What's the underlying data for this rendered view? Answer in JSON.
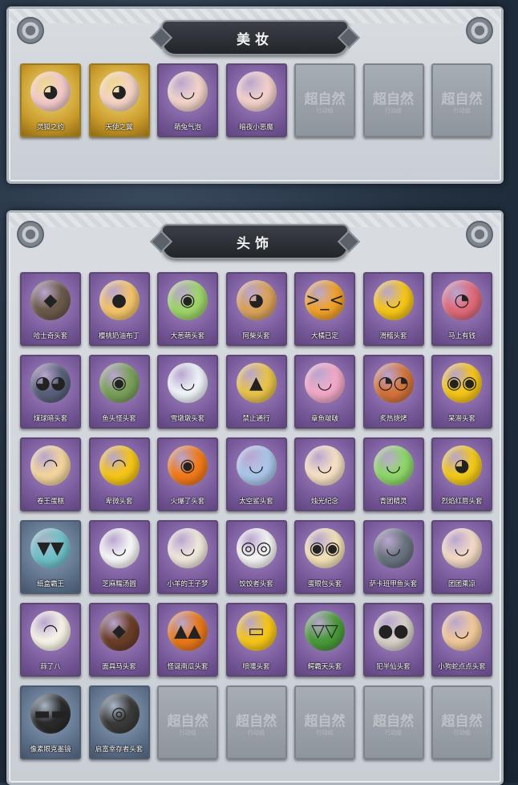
{
  "makeup": {
    "title": "美妆",
    "items": [
      {
        "label": "灵狐之约",
        "style": "gold",
        "icon": "fox-ear-head-icon",
        "glyph": "◕",
        "color": "#f2c9c9"
      },
      {
        "label": "天使之翼",
        "style": "gold",
        "icon": "angel-head-icon",
        "glyph": "◕",
        "color": "#f3d2c4"
      },
      {
        "label": "萌兔气泡",
        "style": "purple",
        "icon": "bunny-head-icon",
        "glyph": "◡",
        "color": "#f1d3c8"
      },
      {
        "label": "暗夜小恶魔",
        "style": "purple",
        "icon": "devil-head-icon",
        "glyph": "◡",
        "color": "#f3d0c9"
      },
      {
        "label": "",
        "style": "locked",
        "icon": "",
        "glyph": "",
        "color": ""
      },
      {
        "label": "",
        "style": "locked",
        "icon": "",
        "glyph": "",
        "color": ""
      },
      {
        "label": "",
        "style": "locked",
        "icon": "",
        "glyph": "",
        "color": ""
      }
    ]
  },
  "headwear": {
    "title": "头饰",
    "items": [
      {
        "label": "哈士奇头套",
        "style": "purple",
        "icon": "husky-head-icon",
        "glyph": "◆",
        "color": "#6b5a4a"
      },
      {
        "label": "樱桃奶油布丁",
        "style": "purple",
        "icon": "pudding-head-icon",
        "glyph": "●",
        "color": "#f2c36a"
      },
      {
        "label": "大葱萌头套",
        "style": "purple",
        "icon": "scallion-head-icon",
        "glyph": "◉",
        "color": "#9ed46a"
      },
      {
        "label": "阿柴头套",
        "style": "purple",
        "icon": "shiba-head-icon",
        "glyph": "◕",
        "color": "#d9a25a"
      },
      {
        "label": "大橘已定",
        "style": "purple",
        "icon": "orange-head-icon",
        "glyph": ">_<",
        "color": "#f0a12a"
      },
      {
        "label": "滑稽头套",
        "style": "purple",
        "icon": "funny-face-icon",
        "glyph": "◡",
        "color": "#f5c518"
      },
      {
        "label": "马上有钱",
        "style": "purple",
        "icon": "horse-money-icon",
        "glyph": "◔",
        "color": "#e06a7a"
      },
      {
        "label": "煤球暗头套",
        "style": "purple",
        "icon": "black-cat-icon",
        "glyph": "◕◕",
        "color": "#59607a"
      },
      {
        "label": "鱼头怪头套",
        "style": "purple",
        "icon": "fish-head-icon",
        "glyph": "◉",
        "color": "#7aa05a"
      },
      {
        "label": "雪墩墩头套",
        "style": "purple",
        "icon": "snowman-head-icon",
        "glyph": "◡",
        "color": "#eef3f8"
      },
      {
        "label": "禁止通行",
        "style": "purple",
        "icon": "traffic-cone-icon",
        "glyph": "▲",
        "color": "#e8c34a"
      },
      {
        "label": "章鱼啵啵",
        "style": "purple",
        "icon": "octopus-head-icon",
        "glyph": "◡",
        "color": "#f2a8c6"
      },
      {
        "label": "炙热烧烤",
        "style": "purple",
        "icon": "sausage-head-icon",
        "glyph": "◔◔",
        "color": "#d4733a"
      },
      {
        "label": "呆滞头套",
        "style": "purple",
        "icon": "dazed-face-icon",
        "glyph": "◉◉",
        "color": "#f5c518"
      },
      {
        "label": "卷王蛋糕",
        "style": "purple",
        "icon": "roll-cake-icon",
        "glyph": "◠",
        "color": "#f2d49c"
      },
      {
        "label": "卑微头套",
        "style": "purple",
        "icon": "humble-face-icon",
        "glyph": "◠",
        "color": "#f5c518"
      },
      {
        "label": "火爆了头套",
        "style": "purple",
        "icon": "fire-head-icon",
        "glyph": "◉",
        "color": "#f27a1a"
      },
      {
        "label": "太空鲨头套",
        "style": "purple",
        "icon": "shark-head-icon",
        "glyph": "◡",
        "color": "#a9c6e8"
      },
      {
        "label": "烛光纪念",
        "style": "purple",
        "icon": "candle-head-icon",
        "glyph": "◡",
        "color": "#f6e0c4"
      },
      {
        "label": "青团精灵",
        "style": "purple",
        "icon": "green-dumpling-icon",
        "glyph": "◡",
        "color": "#8ed66a"
      },
      {
        "label": "烈焰红唇头套",
        "style": "purple",
        "icon": "yellow-mouse-icon",
        "glyph": "◕",
        "color": "#f2c91a"
      },
      {
        "label": "纸盒霸王",
        "style": "blue",
        "icon": "box-dino-icon",
        "glyph": "▼▼",
        "color": "#6fc0c8"
      },
      {
        "label": "芝麻糯汤圆",
        "style": "purple",
        "icon": "rice-ball-icon",
        "glyph": "◡",
        "color": "#f6f6f6"
      },
      {
        "label": "小羊的王子梦",
        "style": "purple",
        "icon": "sheep-crown-icon",
        "glyph": "◡",
        "color": "#efe7dc"
      },
      {
        "label": "饺饺者头套",
        "style": "purple",
        "icon": "dumpling-head-icon",
        "glyph": "◎◎",
        "color": "#f4f4f4"
      },
      {
        "label": "蛋眼包头套",
        "style": "purple",
        "icon": "bun-head-icon",
        "glyph": "◉◉",
        "color": "#f3e1b6"
      },
      {
        "label": "萨卡班甲鱼头套",
        "style": "purple",
        "icon": "ancient-fish-icon",
        "glyph": "◡",
        "color": "#6a7480"
      },
      {
        "label": "团团乘凉",
        "style": "purple",
        "icon": "hamster-head-icon",
        "glyph": "◡",
        "color": "#f3d9c4"
      },
      {
        "label": "蒜了八",
        "style": "purple",
        "icon": "garlic-head-icon",
        "glyph": "◠",
        "color": "#f6f2e6"
      },
      {
        "label": "面具马头套",
        "style": "purple",
        "icon": "horse-mask-icon",
        "glyph": "◆",
        "color": "#6a3e28"
      },
      {
        "label": "怪诞南瓜头套",
        "style": "purple",
        "icon": "pumpkin-head-icon",
        "glyph": "▲▲",
        "color": "#e8781a"
      },
      {
        "label": "喷嚏头套",
        "style": "purple",
        "icon": "grin-face-icon",
        "glyph": "▭",
        "color": "#f5c518"
      },
      {
        "label": "鳄霸天头套",
        "style": "purple",
        "icon": "crocodile-head-icon",
        "glyph": "▽▽",
        "color": "#4a9a3a"
      },
      {
        "label": "犯半仙头套",
        "style": "purple",
        "icon": "bear-glasses-icon",
        "glyph": "●●",
        "color": "#d6d0c8"
      },
      {
        "label": "小狗蛇点点头套",
        "style": "purple",
        "icon": "puppy-head-icon",
        "glyph": "◡",
        "color": "#f0c89a"
      },
      {
        "label": "像素眼克墨镜",
        "style": "blue",
        "icon": "pixel-glasses-icon",
        "glyph": "▬▬",
        "color": "#2a2a2a"
      },
      {
        "label": "启富幸存者头套",
        "style": "blue",
        "icon": "gas-mask-icon",
        "glyph": "◎",
        "color": "#3a3a3a"
      },
      {
        "label": "",
        "style": "locked",
        "icon": "",
        "glyph": "",
        "color": ""
      },
      {
        "label": "",
        "style": "locked",
        "icon": "",
        "glyph": "",
        "color": ""
      },
      {
        "label": "",
        "style": "locked",
        "icon": "",
        "glyph": "",
        "color": ""
      },
      {
        "label": "",
        "style": "locked",
        "icon": "",
        "glyph": "",
        "color": ""
      },
      {
        "label": "",
        "style": "locked",
        "icon": "",
        "glyph": "",
        "color": ""
      }
    ]
  },
  "locked_watermark": "超自然",
  "locked_watermark_sub": "行动组"
}
